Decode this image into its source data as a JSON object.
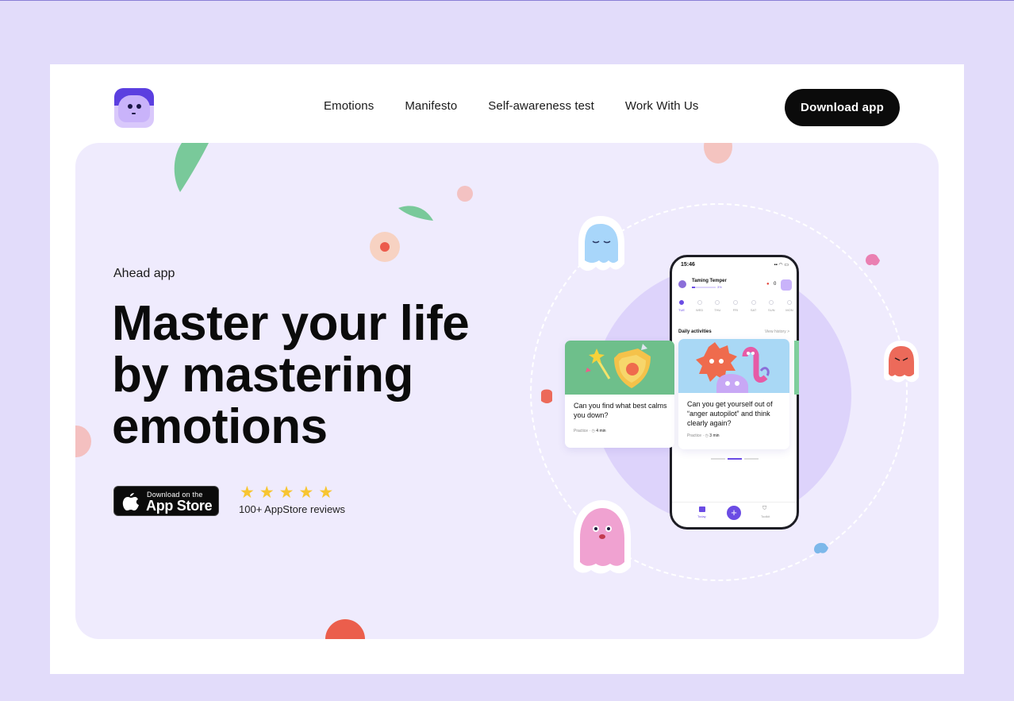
{
  "nav": {
    "items": [
      "Emotions",
      "Manifesto",
      "Self-awareness test",
      "Work With Us"
    ],
    "download_label": "Download app"
  },
  "hero": {
    "eyebrow": "Ahead app",
    "headline": [
      "Master your life",
      "by mastering",
      "emotions"
    ],
    "appstore_small": "Download on the",
    "appstore_big": "App Store",
    "rating_stars": 5,
    "reviews": "100+ AppStore reviews"
  },
  "phone": {
    "time": "15:46",
    "status": "▪▪ ◠ ▭",
    "course_title": "Taming Temper",
    "course_progress": "3%",
    "streak_icon": "drop-icon",
    "streak_count": "0",
    "days": [
      {
        "label": "TUE",
        "active": true
      },
      {
        "label": "WED",
        "active": false
      },
      {
        "label": "THU",
        "active": false
      },
      {
        "label": "FRI",
        "active": false
      },
      {
        "label": "SAT",
        "active": false
      },
      {
        "label": "SUN",
        "active": false
      },
      {
        "label": "MON",
        "active": false
      }
    ],
    "daily_title": "Daily activities",
    "view_history": "View history  >",
    "tabs": {
      "today": "Today",
      "add": "+",
      "tools": "Toolkit"
    }
  },
  "cards": [
    {
      "question": "Can you find what best calms you down?",
      "type": "Practice",
      "duration": "4 min",
      "art_color": "#6ebf8b"
    },
    {
      "question": "Can you get yourself out of “anger autopilot” and think clearly again?",
      "type": "Practice",
      "duration": "3 min",
      "art_color": "#a9d8f5"
    }
  ],
  "colors": {
    "page_bg": "#e2dcfa",
    "hero_bg": "#efebfd",
    "accent": "#6b4ce4",
    "star": "#f7c531",
    "button": "#0b0b0b"
  }
}
